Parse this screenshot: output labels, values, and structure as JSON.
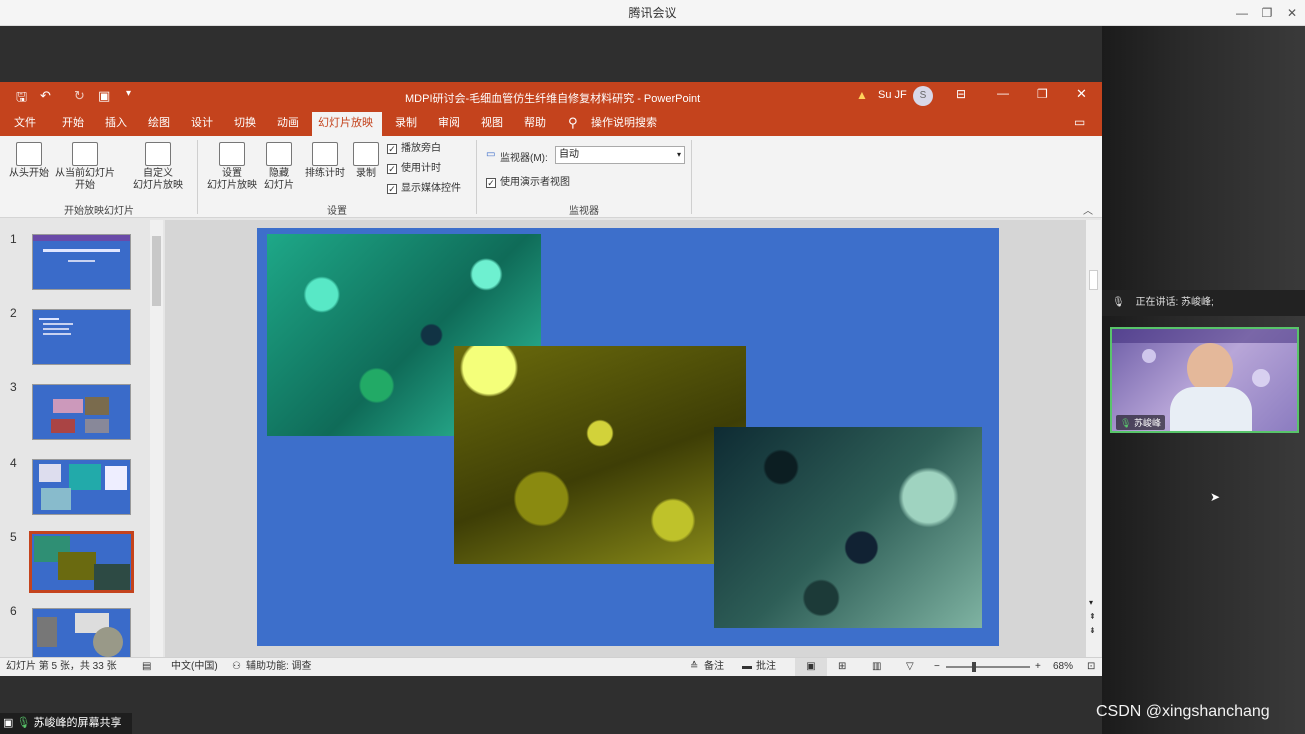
{
  "tencent": {
    "title": "腾讯会议",
    "minimize": "—",
    "restore": "❐",
    "close": "✕"
  },
  "ppt": {
    "title": "MDPI研讨会-毛细血管仿生纤维自修复材料研究 - PowerPoint",
    "user": "Su JF",
    "avatar_initial": "S",
    "tabs": [
      "文件",
      "开始",
      "插入",
      "绘图",
      "设计",
      "切换",
      "动画",
      "幻灯片放映",
      "录制",
      "审阅",
      "视图",
      "帮助"
    ],
    "active_tab": "幻灯片放映",
    "tell_me": "操作说明搜索",
    "ribbon": {
      "from_beginning": "从头开始",
      "from_current_line1": "从当前幻灯片",
      "from_current_line2": "开始",
      "custom_line1": "自定义",
      "custom_line2": "幻灯片放映",
      "group_start": "开始放映幻灯片",
      "setup_line1": "设置",
      "setup_line2": "幻灯片放映",
      "hide_line1": "隐藏",
      "hide_line2": "幻灯片",
      "rehearse": "排练计时",
      "record": "录制",
      "chk_narration": "播放旁白",
      "chk_timing": "使用计时",
      "chk_media": "显示媒体控件",
      "group_setup": "设置",
      "monitor_label": "监视器(M):",
      "monitor_value": "自动",
      "presenter_view": "使用演示者视图",
      "group_monitor": "监视器"
    },
    "thumbnails": [
      "1",
      "2",
      "3",
      "4",
      "5",
      "6"
    ],
    "selected_slide": "5",
    "status": {
      "slide_info": "幻灯片 第 5 张，共 33 张",
      "language": "中文(中国)",
      "accessibility": "辅助功能: 调查",
      "notes": "备注",
      "comments": "批注",
      "zoom": "68%"
    }
  },
  "meeting": {
    "speaking": "正在讲话: 苏峻峰;",
    "participant_name": "苏峻峰",
    "share_label": "苏峻峰的屏幕共享",
    "watermark": "CSDN @xingshanchang"
  },
  "colors": {
    "ppt_accent": "#c4431d",
    "slide_bg": "#3d6fcb",
    "video_border": "#58c46a"
  }
}
